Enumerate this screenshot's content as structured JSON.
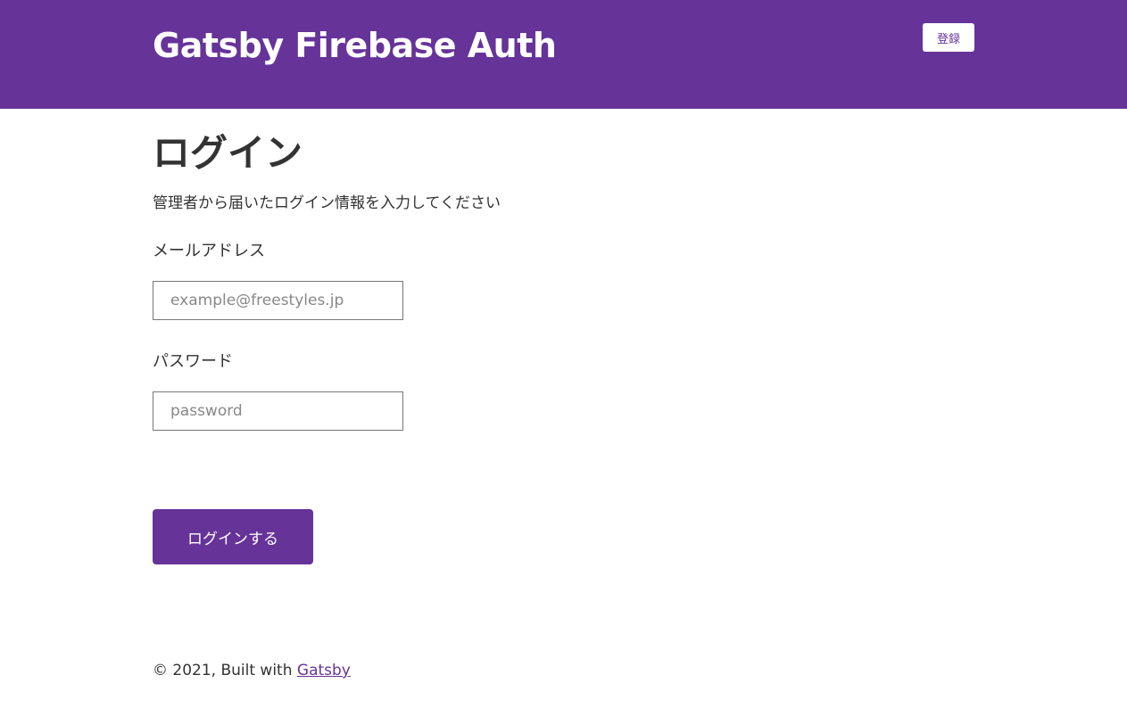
{
  "header": {
    "title": "Gatsby Firebase Auth",
    "register_label": "登録"
  },
  "main": {
    "title": "ログイン",
    "description": "管理者から届いたログイン情報を入力してください",
    "email": {
      "label": "メールアドレス",
      "placeholder": "example@freestyles.jp",
      "value": ""
    },
    "password": {
      "label": "パスワード",
      "placeholder": "password",
      "value": ""
    },
    "submit_label": "ログインする"
  },
  "footer": {
    "copyright": "© 2021, Built with ",
    "link_text": "Gatsby"
  },
  "colors": {
    "brand": "#663399",
    "text": "#333333",
    "background": "#ffffff"
  }
}
